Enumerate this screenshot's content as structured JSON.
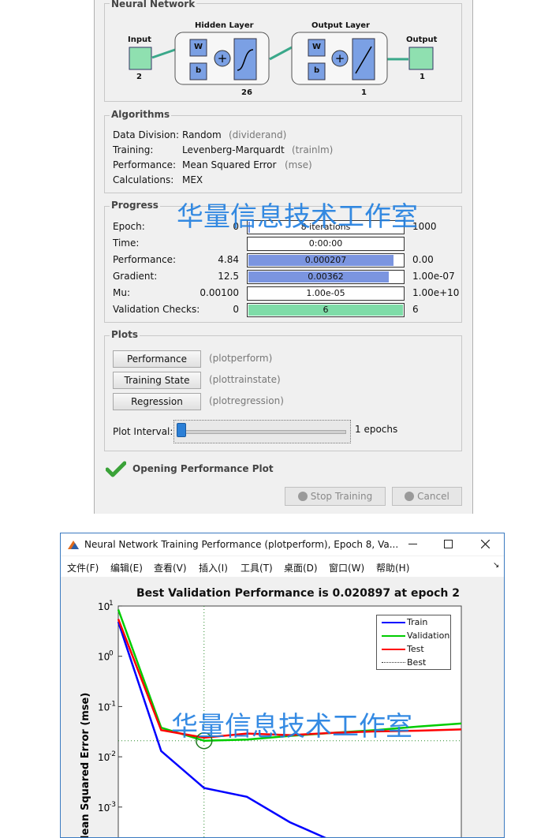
{
  "nn_window": {
    "network_group_title": "Neural Network",
    "diagram": {
      "input_label": "Input",
      "input_size": "2",
      "hidden_layer_label": "Hidden Layer",
      "hidden_size": "26",
      "output_layer_label": "Output Layer",
      "output_layer_size": "1",
      "output_label": "Output",
      "output_size": "1",
      "weight_symbol": "W",
      "bias_symbol": "b"
    },
    "algorithms": {
      "title": "Algorithms",
      "rows": [
        {
          "label": "Data Division:",
          "value": "Random",
          "fn": "(dividerand)"
        },
        {
          "label": "Training:",
          "value": "Levenberg-Marquardt",
          "fn": "(trainlm)"
        },
        {
          "label": "Performance:",
          "value": "Mean Squared Error",
          "fn": "(mse)"
        },
        {
          "label": "Calculations:",
          "value": "MEX",
          "fn": ""
        }
      ]
    },
    "progress": {
      "title": "Progress",
      "rows": [
        {
          "label": "Epoch:",
          "start": "0",
          "current": "8 iterations",
          "end": "1000",
          "fraction": 0.008
        },
        {
          "label": "Time:",
          "start": "",
          "current": "0:00:00",
          "end": "",
          "fraction": 0
        },
        {
          "label": "Performance:",
          "start": "4.84",
          "current": "0.000207",
          "end": "0.00",
          "fraction": 0.94
        },
        {
          "label": "Gradient:",
          "start": "12.5",
          "current": "0.00362",
          "end": "1.00e-07",
          "fraction": 0.91
        },
        {
          "label": "Mu:",
          "start": "0.00100",
          "current": "1.00e-05",
          "end": "1.00e+10",
          "fraction": 0
        },
        {
          "label": "Validation Checks:",
          "start": "0",
          "current": "6",
          "end": "6",
          "fraction": 1.0
        }
      ]
    },
    "plots": {
      "title": "Plots",
      "buttons": [
        {
          "label": "Performance",
          "fn": "(plotperform)"
        },
        {
          "label": "Training State",
          "fn": "(plottrainstate)"
        },
        {
          "label": "Regression",
          "fn": "(plotregression)"
        }
      ],
      "interval_label": "Plot Interval:",
      "interval_value": "1 epochs"
    },
    "status_text": "Opening Performance Plot",
    "stop_training_label": "Stop Training",
    "cancel_label": "Cancel"
  },
  "watermark_text": "华量信息技术工作室",
  "figure_window": {
    "title": "Neural Network Training Performance (plotperform), Epoch 8, Va...",
    "menu": [
      "文件(F)",
      "编辑(E)",
      "查看(V)",
      "插入(I)",
      "工具(T)",
      "桌面(D)",
      "窗口(W)",
      "帮助(H)"
    ]
  },
  "chart_data": {
    "type": "line",
    "title": "Best Validation Performance is 0.020897 at epoch 2",
    "ylabel": "Mean Squared Error  (mse)",
    "yscale": "log",
    "y_tick_exponents": [
      1,
      0,
      -1,
      -2,
      -3
    ],
    "legend_position": "top-right",
    "series": [
      {
        "name": "Train",
        "color": "#0000ff",
        "x": [
          0,
          1,
          2,
          3,
          4,
          5
        ],
        "y": [
          4.84,
          0.013,
          0.0024,
          0.0016,
          0.0005,
          0.00021
        ]
      },
      {
        "name": "Validation",
        "color": "#00cc00",
        "x": [
          0,
          1,
          2,
          3,
          4,
          5,
          6,
          7,
          8
        ],
        "y": [
          8.5,
          0.038,
          0.020897,
          0.022,
          0.026,
          0.03,
          0.034,
          0.04,
          0.046
        ]
      },
      {
        "name": "Test",
        "color": "#ff0000",
        "x": [
          0,
          1,
          2,
          3,
          4,
          5,
          6,
          7,
          8
        ],
        "y": [
          5.5,
          0.034,
          0.024,
          0.029,
          0.027,
          0.03,
          0.032,
          0.033,
          0.035
        ]
      }
    ],
    "best": {
      "name": "Best",
      "x": 2,
      "y": 0.020897
    }
  }
}
